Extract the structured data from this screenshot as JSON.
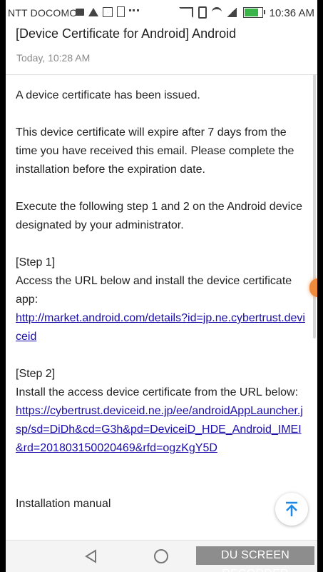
{
  "status_bar": {
    "carrier": "NTT DOCOMO",
    "time": "10:36 AM",
    "battery_color": "#3ab54a"
  },
  "email": {
    "subject": "[Device Certificate for Android] Android",
    "date": "Today, 10:28 AM",
    "issued_line": "A device certificate has been issued.",
    "expiry_paragraph": "This device certificate will expire after 7 days from the time you have received this email. Please complete the installation before the expiration date.",
    "instructions": "Execute the following step 1 and 2 on the Android device designated by your administrator.",
    "step1_heading": "[Step 1]",
    "step1_text": "Access the URL below and install the device certificate app:",
    "step1_link": "http://market.android.com/details?id=jp.ne.cybertrust.deviceid",
    "step2_heading": "[Step 2]",
    "step2_text": "Install the access device certificate from the URL below:",
    "step2_link": "https://cybertrust.deviceid.ne.jp/ee/androidAppLauncher.jsp/sd=DiDh&cd=G3h&pd=DeviceiD_HDE_Android_IMEI&rd=20180315002046​9&rfd=ogzKgY5D",
    "manual_heading": "Installation manual"
  },
  "fab": {
    "icon": "scroll-to-top-icon",
    "color": "#1e88e5"
  },
  "navbar": {
    "back_icon": "back-icon",
    "home_icon": "home-icon"
  },
  "watermark": "DU SCREEN RECORDER",
  "accent_link_color": "#1a0dab"
}
